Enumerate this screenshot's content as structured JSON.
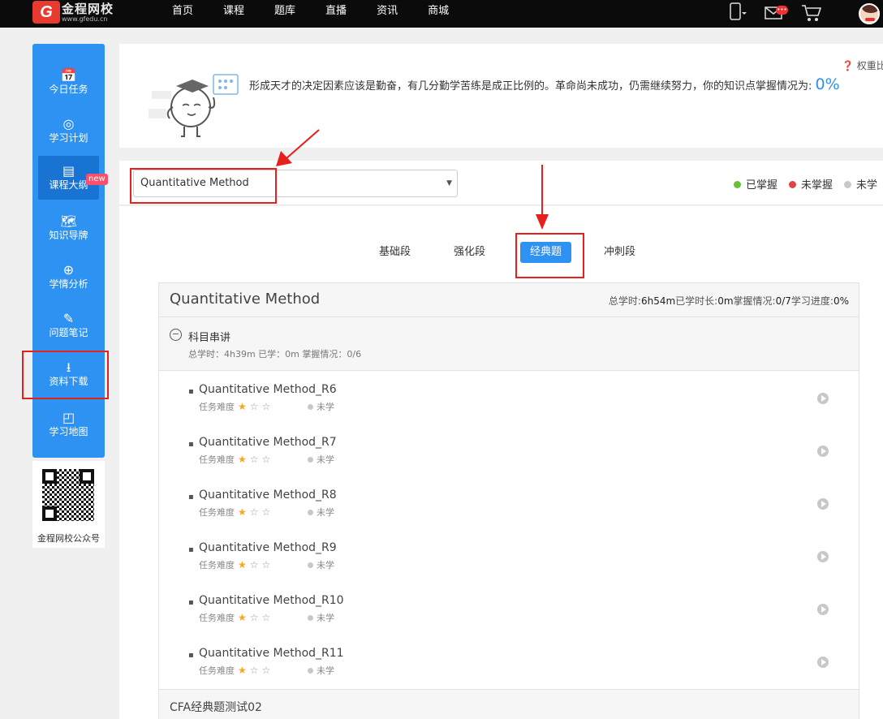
{
  "topbar": {
    "logo_mark": "G",
    "logo_title": "金程网校",
    "logo_url_text": "www.gfedu.cn",
    "nav": [
      "首页",
      "课程",
      "题库",
      "直播",
      "资讯",
      "商城"
    ],
    "mail_badge": "•••"
  },
  "sidebar": {
    "items": [
      {
        "icon": "📅",
        "label": "今日任务"
      },
      {
        "icon": "◎",
        "label": "学习计划"
      },
      {
        "icon": "▤",
        "label": "课程大纲",
        "badge": "new"
      },
      {
        "icon": "🗺",
        "label": "知识导牌"
      },
      {
        "icon": "⊕",
        "label": "学情分析"
      },
      {
        "icon": "✎",
        "label": "问题笔记"
      },
      {
        "icon": "⭳",
        "label": "资料下载"
      },
      {
        "icon": "◰",
        "label": "学习地图"
      }
    ],
    "qr_label": "金程网校公众号"
  },
  "banner": {
    "text": "形成天才的决定因素应该是勤奋，有几分勤学苦练是成正比例的。革命尚未成功，仍需继续努力，你的知识点掌握情况为:",
    "percent": "0%",
    "weight_link": "权重比"
  },
  "filter": {
    "subject_selected": "Quantitative Method",
    "legend": [
      {
        "label": "已掌握",
        "color": "#67c23a"
      },
      {
        "label": "未掌握",
        "color": "#e04545"
      },
      {
        "label": "未学",
        "color": "#c8c8c8"
      }
    ]
  },
  "tabs": [
    "基础段",
    "强化段",
    "经典题",
    "冲刺段"
  ],
  "tab_active_index": 2,
  "card": {
    "title": "Quantitative Method",
    "stats": {
      "total_label": "总学时:",
      "total_value": "6h54m",
      "studied_label": "已学时长:",
      "studied_value": "0m",
      "mastery_label": "掌握情况:",
      "mastery_value": "0/7",
      "progress_label": "学习进度:",
      "progress_value": "0%"
    },
    "section": {
      "toggle": "−",
      "title": "科目串讲",
      "meta": "总学时：4h39m    已学：0m    掌握情况：0/6"
    },
    "difficulty_label": "任务难度",
    "stars_filled": 1,
    "stars_total": 3,
    "status_label": "未学",
    "items": [
      "Quantitative Method_R6",
      "Quantitative Method_R7",
      "Quantitative Method_R8",
      "Quantitative Method_R9",
      "Quantitative Method_R10",
      "Quantitative Method_R11"
    ],
    "footer_title": "CFA经典题测试02"
  }
}
